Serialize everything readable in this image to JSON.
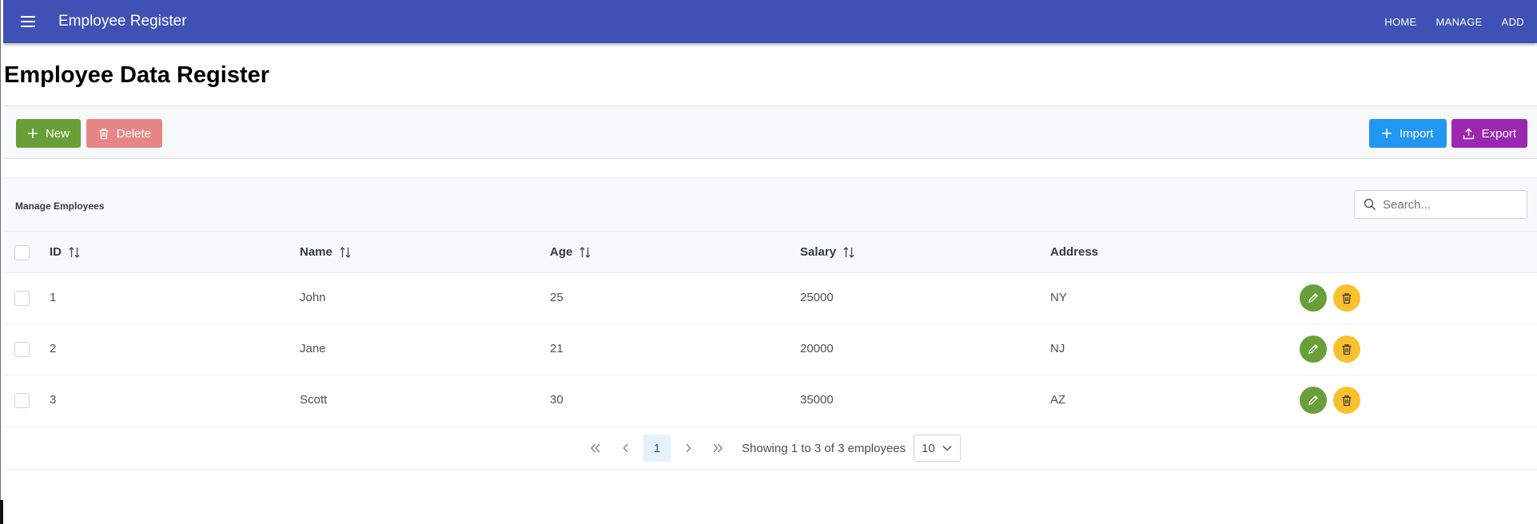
{
  "appbar": {
    "title": "Employee Register",
    "nav": [
      "HOME",
      "MANAGE",
      "ADD"
    ],
    "color": "#3f51b5"
  },
  "page": {
    "title": "Employee Data Register"
  },
  "toolbar": {
    "new_label": "New",
    "delete_label": "Delete",
    "import_label": "Import",
    "export_label": "Export"
  },
  "table": {
    "title": "Manage Employees",
    "search_placeholder": "Search...",
    "columns": [
      "ID",
      "Name",
      "Age",
      "Salary",
      "Address"
    ],
    "rows": [
      {
        "id": "1",
        "name": "John",
        "age": "25",
        "salary": "25000",
        "address": "NY"
      },
      {
        "id": "2",
        "name": "Jane",
        "age": "21",
        "salary": "20000",
        "address": "NJ"
      },
      {
        "id": "3",
        "name": "Scott",
        "age": "30",
        "salary": "35000",
        "address": "AZ"
      }
    ]
  },
  "paginator": {
    "current_page": "1",
    "report": "Showing 1 to 3 of 3 employees",
    "rows_per_page": "10"
  }
}
